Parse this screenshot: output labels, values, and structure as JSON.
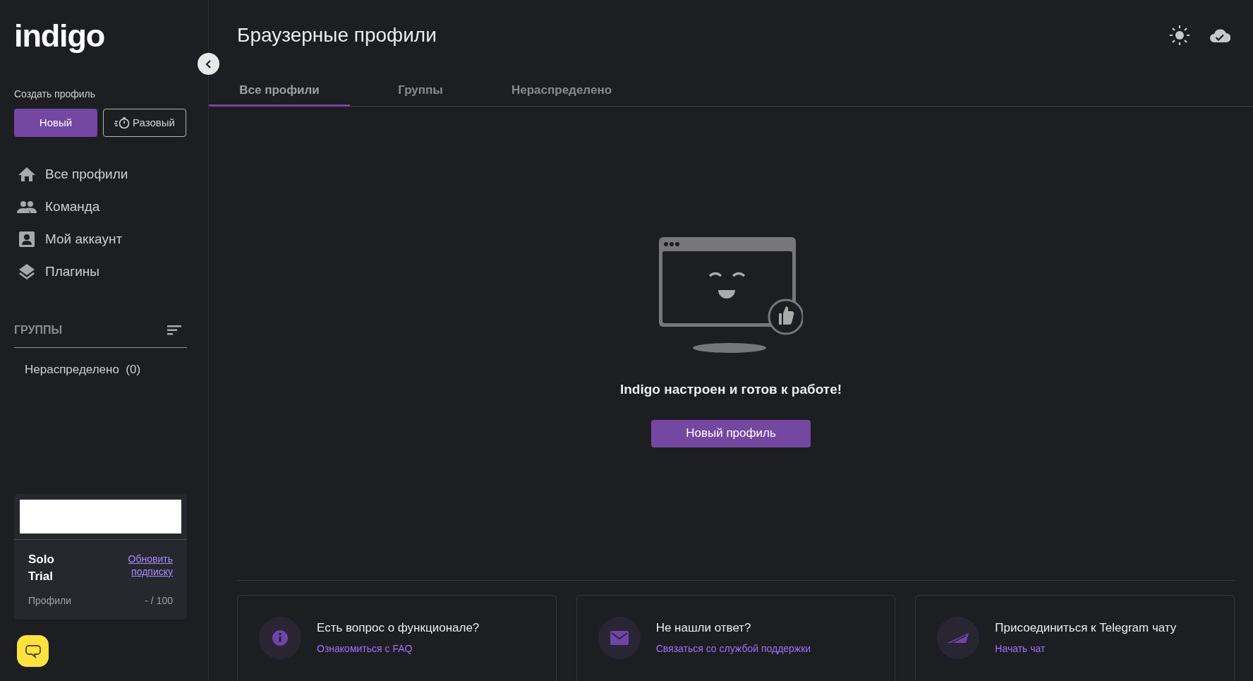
{
  "sidebar": {
    "logo": "indigo",
    "create_label": "Создать профиль",
    "create_buttons": [
      {
        "kind": "primary",
        "label": "Новый"
      },
      {
        "kind": "timer",
        "label": "Разовый"
      }
    ],
    "nav": [
      {
        "kind": "home",
        "label": "Все профили"
      },
      {
        "kind": "team",
        "label": "Команда"
      },
      {
        "kind": "account",
        "label": "Мой аккаунт"
      },
      {
        "kind": "plugins",
        "label": "Плагины"
      }
    ],
    "groups_heading": "ГРУППЫ",
    "groups": [
      {
        "label": "Нераспределено",
        "count": "(0)"
      }
    ],
    "plan": {
      "name": "Solo\nTrial",
      "upgrade_link": "Обновить подписку",
      "profiles_label": "Профили",
      "profiles_value": "- / 100"
    }
  },
  "header": {
    "title": "Браузерные профили"
  },
  "tabs": [
    {
      "label": "Все профили",
      "selected": true
    },
    {
      "label": "Группы",
      "selected": false
    },
    {
      "label": "Нераспределено",
      "selected": false
    }
  ],
  "empty_state": {
    "message": "Indigo настроен и готов к работе!",
    "button": "Новый профиль"
  },
  "help_cards": [
    {
      "kind": "info",
      "title": "Есть вопрос о функционале?",
      "link": "Ознакомиться с FAQ"
    },
    {
      "kind": "mail",
      "title": "Не нашли ответ?",
      "link": "Связаться со службой поддержки"
    },
    {
      "kind": "telegram",
      "title": "Присоединиться к Telegram чату",
      "link": "Начать чат"
    }
  ]
}
